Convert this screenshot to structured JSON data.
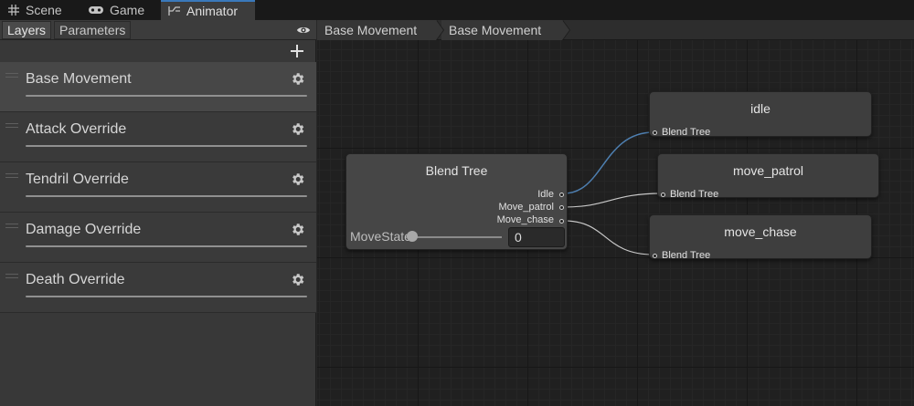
{
  "window_tabs": [
    {
      "label": "Scene",
      "icon": "grid-icon"
    },
    {
      "label": "Game",
      "icon": "gamepad-icon"
    },
    {
      "label": "Animator",
      "icon": "animator-icon",
      "active": true
    }
  ],
  "left_panel": {
    "tabs": [
      {
        "label": "Layers",
        "active": true
      },
      {
        "label": "Parameters",
        "active": false
      }
    ],
    "layers": [
      {
        "name": "Base Movement",
        "selected": true
      },
      {
        "name": "Attack Override",
        "selected": false
      },
      {
        "name": "Tendril Override",
        "selected": false
      },
      {
        "name": "Damage Override",
        "selected": false
      },
      {
        "name": "Death Override",
        "selected": false
      }
    ]
  },
  "breadcrumbs": [
    "Base Movement",
    "Base Movement"
  ],
  "graph": {
    "blend_tree": {
      "title": "Blend Tree",
      "outputs": [
        "Idle",
        "Move_patrol",
        "Move_chase"
      ],
      "parameter_label": "MoveState",
      "parameter_value": "0",
      "slider_fraction": 0
    },
    "motion_nodes": [
      {
        "title": "idle",
        "input_label": "Blend Tree"
      },
      {
        "title": "move_patrol",
        "input_label": "Blend Tree"
      },
      {
        "title": "move_chase",
        "input_label": "Blend Tree"
      }
    ]
  },
  "colors": {
    "accent": "#3a79bb",
    "wire_selected": "#4e7fb0",
    "wire": "#c8c8c8"
  }
}
